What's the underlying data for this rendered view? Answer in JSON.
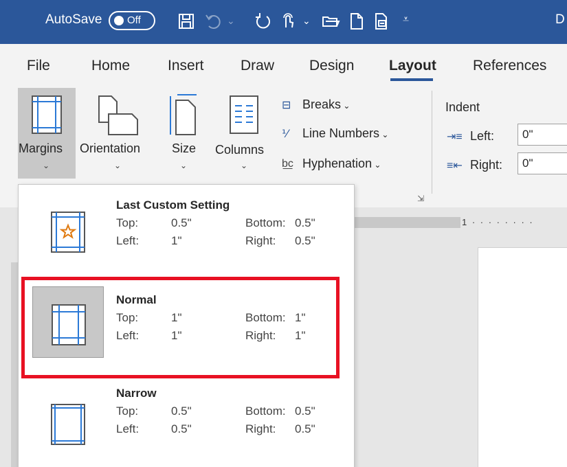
{
  "titlebar": {
    "autosave_label": "AutoSave",
    "autosave_state": "Off",
    "doc_title_fragment": "D",
    "icons": [
      "save-icon",
      "undo-icon",
      "redo-icon",
      "touch-mode-icon",
      "open-folder-icon",
      "new-document-icon",
      "print-preview-icon",
      "customize-qat-icon"
    ],
    "accent_color": "#2b579a"
  },
  "tabs": [
    {
      "label": "File"
    },
    {
      "label": "Home"
    },
    {
      "label": "Insert"
    },
    {
      "label": "Draw"
    },
    {
      "label": "Design"
    },
    {
      "label": "Layout",
      "active": true
    },
    {
      "label": "References"
    }
  ],
  "ribbon": {
    "margins": "Margins",
    "orientation": "Orientation",
    "size": "Size",
    "columns": "Columns",
    "breaks": "Breaks",
    "line_numbers": "Line Numbers",
    "hyphenation": "Hyphenation",
    "indent": {
      "title": "Indent",
      "left_label": "Left:",
      "left_value": "0\"",
      "right_label": "Right:",
      "right_value": "0\""
    }
  },
  "ruler_text": "1 · · · · · · · ·",
  "margin_options": [
    {
      "title": "Last Custom Setting",
      "top_label": "Top:",
      "top": "0.5\"",
      "bottom_label": "Bottom:",
      "bottom": "0.5\"",
      "left_label": "Left:",
      "left": "1\"",
      "right_label": "Right:",
      "right": "0.5\"",
      "icon": "custom-margins-star-icon"
    },
    {
      "title": "Normal",
      "top_label": "Top:",
      "top": "1\"",
      "bottom_label": "Bottom:",
      "bottom": "1\"",
      "left_label": "Left:",
      "left": "1\"",
      "right_label": "Right:",
      "right": "1\"",
      "icon": "normal-margins-icon",
      "selected": true
    },
    {
      "title": "Narrow",
      "top_label": "Top:",
      "top": "0.5\"",
      "bottom_label": "Bottom:",
      "bottom": "0.5\"",
      "left_label": "Left:",
      "left": "0.5\"",
      "right_label": "Right:",
      "right": "0.5\"",
      "icon": "narrow-margins-icon"
    }
  ],
  "colors": {
    "highlight": "#e81123",
    "selected_bg": "#c8c8c8",
    "margin_line": "#2b79d6"
  }
}
